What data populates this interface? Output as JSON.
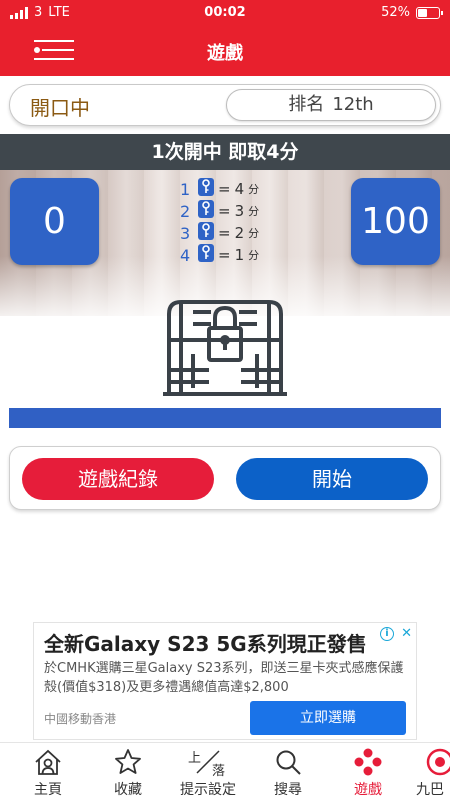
{
  "status_bar": {
    "carrier": "3",
    "network": "LTE",
    "time": "00:02",
    "battery": "52%",
    "battery_level": 0.52
  },
  "header": {
    "title": "遊戲"
  },
  "info": {
    "open_status": "開口中",
    "rank_label": "排名",
    "rank_value": "12th"
  },
  "banner": {
    "text": "1次開中 即取4分"
  },
  "scores": {
    "left": "0",
    "right": "100"
  },
  "legend": [
    {
      "num": "1",
      "eq": "=",
      "value": "4",
      "unit": "分"
    },
    {
      "num": "2",
      "eq": "=",
      "value": "3",
      "unit": "分"
    },
    {
      "num": "3",
      "eq": "=",
      "value": "2",
      "unit": "分"
    },
    {
      "num": "4",
      "eq": "=",
      "value": "1",
      "unit": "分"
    }
  ],
  "progress": {
    "value": 1.0
  },
  "actions": {
    "record_label": "遊戲紀錄",
    "start_label": "開始"
  },
  "ad": {
    "title": "全新Galaxy S23 5G系列現正發售",
    "description": "於CMHK選購三星Galaxy S23系列，即送三星卡夾式感應保護殼(價值$318)及更多禮遇總值高達$2,800",
    "advertiser": "中國移動香港",
    "cta": "立即選購",
    "info_glyph": "i",
    "close_glyph": "✕"
  },
  "nav": [
    {
      "label": "主頁",
      "icon": "home-icon"
    },
    {
      "label": "收藏",
      "icon": "star-icon"
    },
    {
      "label": "提示設定",
      "icon": "up-down-icon",
      "icon_text_top": "上",
      "icon_text_bottom": "落"
    },
    {
      "label": "搜尋",
      "icon": "search-icon"
    },
    {
      "label": "遊戲",
      "icon": "dots-icon",
      "active": true
    },
    {
      "label": "九巴",
      "icon": "kmb-icon"
    }
  ],
  "colors": {
    "brand_red": "#e8202d",
    "blue": "#2f63c6",
    "dark_banner": "#3f474d",
    "start_blue": "#0c61c8",
    "record_red": "#e61d3a"
  }
}
